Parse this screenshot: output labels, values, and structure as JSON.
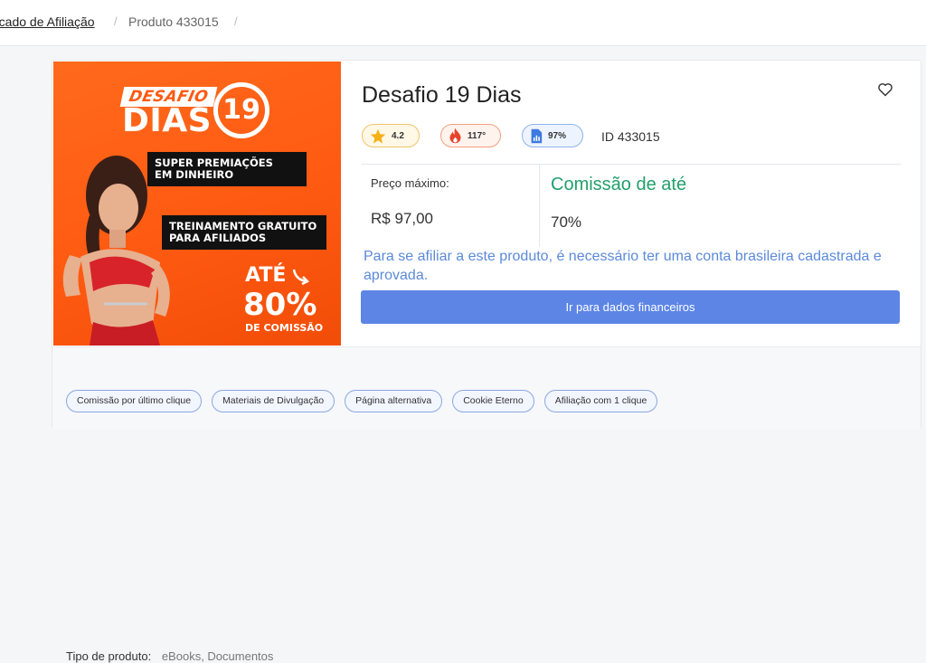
{
  "breadcrumb": {
    "parent": "rcado de Afiliação",
    "separator": "/",
    "current": "Produto 433015"
  },
  "banner": {
    "desafio": "DESAFIO",
    "dias": "DIAS",
    "number": "19",
    "box1": "SUPER PREMIAÇÕES\nEM DINHEIRO",
    "box2": "TREINAMENTO GRATUITO\nPARA AFILIADOS",
    "ate": "ATÉ",
    "percent": "80%",
    "commission": "DE COMISSÃO"
  },
  "product": {
    "title": "Desafio 19 Dias",
    "rating": "4.2",
    "temperature": "117°",
    "conversion": "97%",
    "id_label": "ID 433015",
    "price_label": "Preço máximo:",
    "price_value": "R$ 97,00",
    "commission_label": "Comissão de até",
    "commission_value": "70%",
    "notice": "Para se afiliar a este produto, é necessário ter uma conta brasileira cadastrada e aprovada.",
    "cta_label": "Ir para dados financeiros"
  },
  "footer": {
    "type_label": "Tipo de produto:",
    "type_value": "eBooks, Documentos",
    "tags": [
      "Comissão por último clique",
      "Materiais de Divulgação",
      "Página alternativa",
      "Cookie Eterno",
      "Afiliação com 1 clique"
    ]
  },
  "colors": {
    "accent": "#5c85e6",
    "commission_green": "#22a06b",
    "banner_orange": "#ff5a12",
    "notice_blue": "#5b8ad8"
  },
  "icons": {
    "rating": "star-icon",
    "temperature": "fire-icon",
    "conversion": "chart-file-icon",
    "favorite": "heart-icon"
  }
}
